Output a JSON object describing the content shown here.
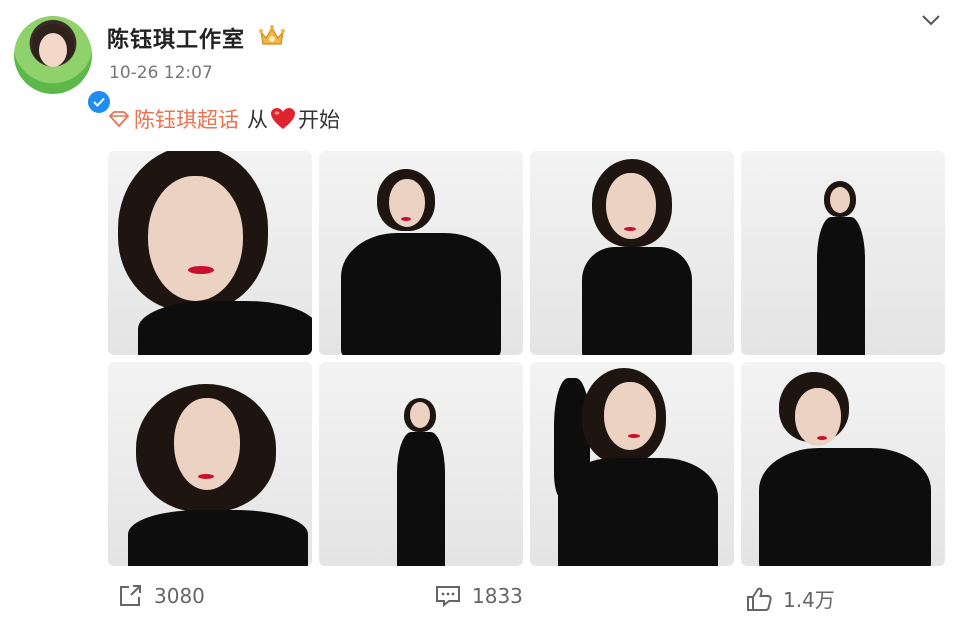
{
  "post": {
    "author": "陈钰琪工作室",
    "time": "10-26 12:07",
    "topic": "陈钰琪超话",
    "text_before_heart": "从",
    "text_after_heart": "开始"
  },
  "photos": [
    {
      "alt": "portrait close-up with windswept hair"
    },
    {
      "alt": "seated pose in black outfit"
    },
    {
      "alt": "half-body portrait in black outfit"
    },
    {
      "alt": "full-body standing pose"
    },
    {
      "alt": "portrait with flowing hair"
    },
    {
      "alt": "full-body standing pose, hands in pockets"
    },
    {
      "alt": "pose with hand in hair"
    },
    {
      "alt": "seated pose, hand at neck"
    }
  ],
  "actions": {
    "repost_count": "3080",
    "comment_count": "1833",
    "like_count": "1.4万"
  },
  "colors": {
    "topic": "#eb7350",
    "verified": "#1f8ef1",
    "crown": "#f0b64a"
  },
  "icons": [
    "verified-icon",
    "crown-badge-icon",
    "chevron-down-icon",
    "topic-diamond-icon",
    "heart-emoji-icon",
    "repost-icon",
    "comment-icon",
    "like-icon"
  ]
}
